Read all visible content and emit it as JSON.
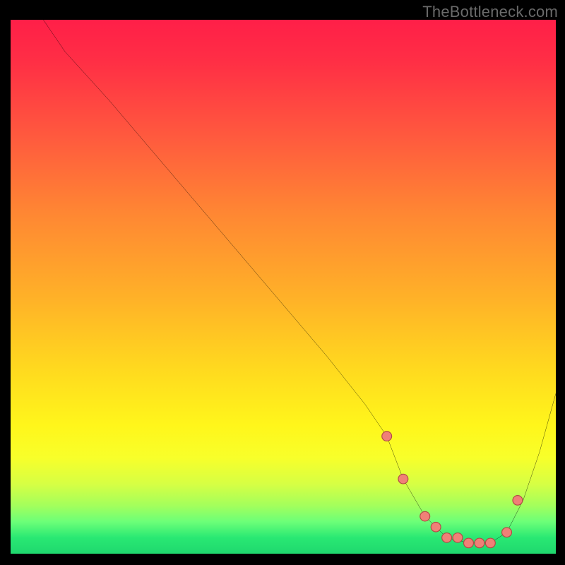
{
  "watermark": "TheBottleneck.com",
  "chart_data": {
    "type": "line",
    "title": "",
    "xlabel": "",
    "ylabel": "",
    "xlim": [
      0,
      100
    ],
    "ylim": [
      0,
      100
    ],
    "grid": false,
    "legend": false,
    "series": [
      {
        "name": "bottleneck-curve",
        "x": [
          0,
          6,
          10,
          18,
          28,
          38,
          48,
          58,
          65,
          69,
          72,
          76,
          80,
          84,
          88,
          91,
          94,
          97,
          100
        ],
        "y": [
          104,
          100,
          94,
          85,
          73,
          61,
          49,
          37,
          28,
          22,
          14,
          7,
          3,
          2,
          2,
          4,
          10,
          19,
          30
        ]
      }
    ],
    "markers": {
      "name": "highlight-points",
      "x": [
        69,
        72,
        76,
        78,
        80,
        82,
        84,
        86,
        88,
        91,
        93
      ],
      "y": [
        22,
        14,
        7,
        5,
        3,
        3,
        2,
        2,
        2,
        4,
        10
      ]
    },
    "background_gradient": {
      "top_color": "#ff1f48",
      "mid_color": "#ffd81f",
      "bottom_color": "#1fd86e"
    }
  }
}
